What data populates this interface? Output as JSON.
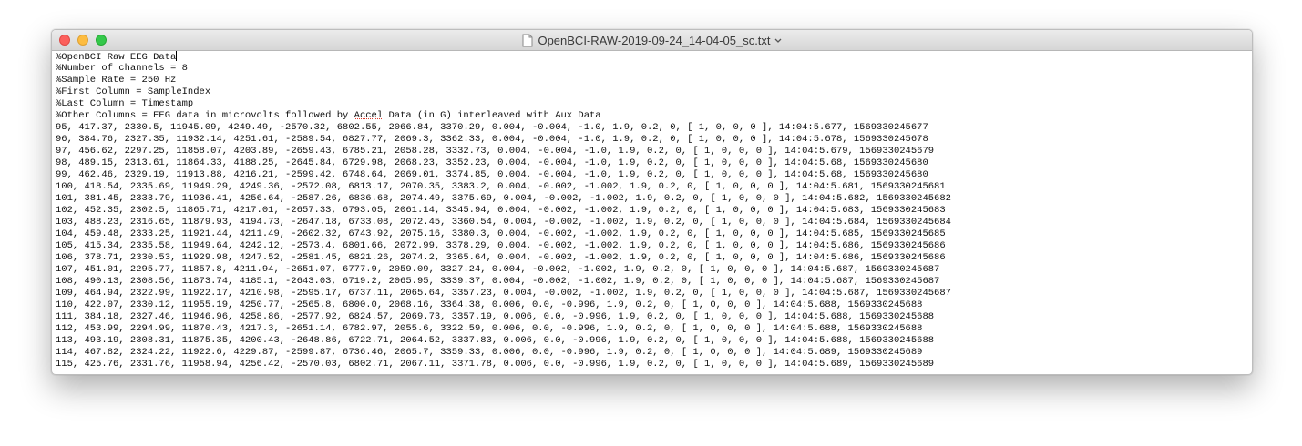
{
  "window": {
    "title": "OpenBCI-RAW-2019-09-24_14-04-05_sc.txt"
  },
  "editor": {
    "misspelled_word": "Accel",
    "lines": [
      "%OpenBCI Raw EEG Data",
      "%Number of channels = 8",
      "%Sample Rate = 250 Hz",
      "%First Column = SampleIndex",
      "%Last Column = Timestamp",
      "%Other Columns = EEG data in microvolts followed by Accel Data (in G) interleaved with Aux Data",
      "95, 417.37, 2330.5, 11945.09, 4249.49, -2570.32, 6802.55, 2066.84, 3370.29, 0.004, -0.004, -1.0, 1.9, 0.2, 0, [ 1, 0, 0, 0 ], 14:04:5.677, 1569330245677",
      "96, 384.76, 2327.35, 11932.14, 4251.61, -2589.54, 6827.77, 2069.3, 3362.33, 0.004, -0.004, -1.0, 1.9, 0.2, 0, [ 1, 0, 0, 0 ], 14:04:5.678, 1569330245678",
      "97, 456.62, 2297.25, 11858.07, 4203.89, -2659.43, 6785.21, 2058.28, 3332.73, 0.004, -0.004, -1.0, 1.9, 0.2, 0, [ 1, 0, 0, 0 ], 14:04:5.679, 1569330245679",
      "98, 489.15, 2313.61, 11864.33, 4188.25, -2645.84, 6729.98, 2068.23, 3352.23, 0.004, -0.004, -1.0, 1.9, 0.2, 0, [ 1, 0, 0, 0 ], 14:04:5.68, 1569330245680",
      "99, 462.46, 2329.19, 11913.88, 4216.21, -2599.42, 6748.64, 2069.01, 3374.85, 0.004, -0.004, -1.0, 1.9, 0.2, 0, [ 1, 0, 0, 0 ], 14:04:5.68, 1569330245680",
      "100, 418.54, 2335.69, 11949.29, 4249.36, -2572.08, 6813.17, 2070.35, 3383.2, 0.004, -0.002, -1.002, 1.9, 0.2, 0, [ 1, 0, 0, 0 ], 14:04:5.681, 1569330245681",
      "101, 381.45, 2333.79, 11936.41, 4256.64, -2587.26, 6836.68, 2074.49, 3375.69, 0.004, -0.002, -1.002, 1.9, 0.2, 0, [ 1, 0, 0, 0 ], 14:04:5.682, 1569330245682",
      "102, 452.35, 2302.5, 11865.71, 4217.01, -2657.33, 6793.05, 2061.14, 3345.94, 0.004, -0.002, -1.002, 1.9, 0.2, 0, [ 1, 0, 0, 0 ], 14:04:5.683, 1569330245683",
      "103, 488.23, 2316.65, 11879.93, 4194.73, -2647.18, 6733.08, 2072.45, 3360.54, 0.004, -0.002, -1.002, 1.9, 0.2, 0, [ 1, 0, 0, 0 ], 14:04:5.684, 1569330245684",
      "104, 459.48, 2333.25, 11921.44, 4211.49, -2602.32, 6743.92, 2075.16, 3380.3, 0.004, -0.002, -1.002, 1.9, 0.2, 0, [ 1, 0, 0, 0 ], 14:04:5.685, 1569330245685",
      "105, 415.34, 2335.58, 11949.64, 4242.12, -2573.4, 6801.66, 2072.99, 3378.29, 0.004, -0.002, -1.002, 1.9, 0.2, 0, [ 1, 0, 0, 0 ], 14:04:5.686, 1569330245686",
      "106, 378.71, 2330.53, 11929.98, 4247.52, -2581.45, 6821.26, 2074.2, 3365.64, 0.004, -0.002, -1.002, 1.9, 0.2, 0, [ 1, 0, 0, 0 ], 14:04:5.686, 1569330245686",
      "107, 451.01, 2295.77, 11857.8, 4211.94, -2651.07, 6777.9, 2059.09, 3327.24, 0.004, -0.002, -1.002, 1.9, 0.2, 0, [ 1, 0, 0, 0 ], 14:04:5.687, 1569330245687",
      "108, 490.13, 2308.56, 11873.74, 4185.1, -2643.03, 6719.2, 2065.95, 3339.37, 0.004, -0.002, -1.002, 1.9, 0.2, 0, [ 1, 0, 0, 0 ], 14:04:5.687, 1569330245687",
      "109, 464.94, 2322.99, 11922.17, 4210.98, -2595.17, 6737.11, 2065.64, 3357.23, 0.004, -0.002, -1.002, 1.9, 0.2, 0, [ 1, 0, 0, 0 ], 14:04:5.687, 1569330245687",
      "110, 422.07, 2330.12, 11955.19, 4250.77, -2565.8, 6800.0, 2068.16, 3364.38, 0.006, 0.0, -0.996, 1.9, 0.2, 0, [ 1, 0, 0, 0 ], 14:04:5.688, 1569330245688",
      "111, 384.18, 2327.46, 11946.96, 4258.86, -2577.92, 6824.57, 2069.73, 3357.19, 0.006, 0.0, -0.996, 1.9, 0.2, 0, [ 1, 0, 0, 0 ], 14:04:5.688, 1569330245688",
      "112, 453.99, 2294.99, 11870.43, 4217.3, -2651.14, 6782.97, 2055.6, 3322.59, 0.006, 0.0, -0.996, 1.9, 0.2, 0, [ 1, 0, 0, 0 ], 14:04:5.688, 1569330245688",
      "113, 493.19, 2308.31, 11875.35, 4200.43, -2648.86, 6722.71, 2064.52, 3337.83, 0.006, 0.0, -0.996, 1.9, 0.2, 0, [ 1, 0, 0, 0 ], 14:04:5.688, 1569330245688",
      "114, 467.82, 2324.22, 11922.6, 4229.87, -2599.87, 6736.46, 2065.7, 3359.33, 0.006, 0.0, -0.996, 1.9, 0.2, 0, [ 1, 0, 0, 0 ], 14:04:5.689, 1569330245689",
      "115, 425.76, 2331.76, 11958.94, 4256.42, -2570.03, 6802.71, 2067.11, 3371.78, 0.006, 0.0, -0.996, 1.9, 0.2, 0, [ 1, 0, 0, 0 ], 14:04:5.689, 1569330245689"
    ]
  }
}
